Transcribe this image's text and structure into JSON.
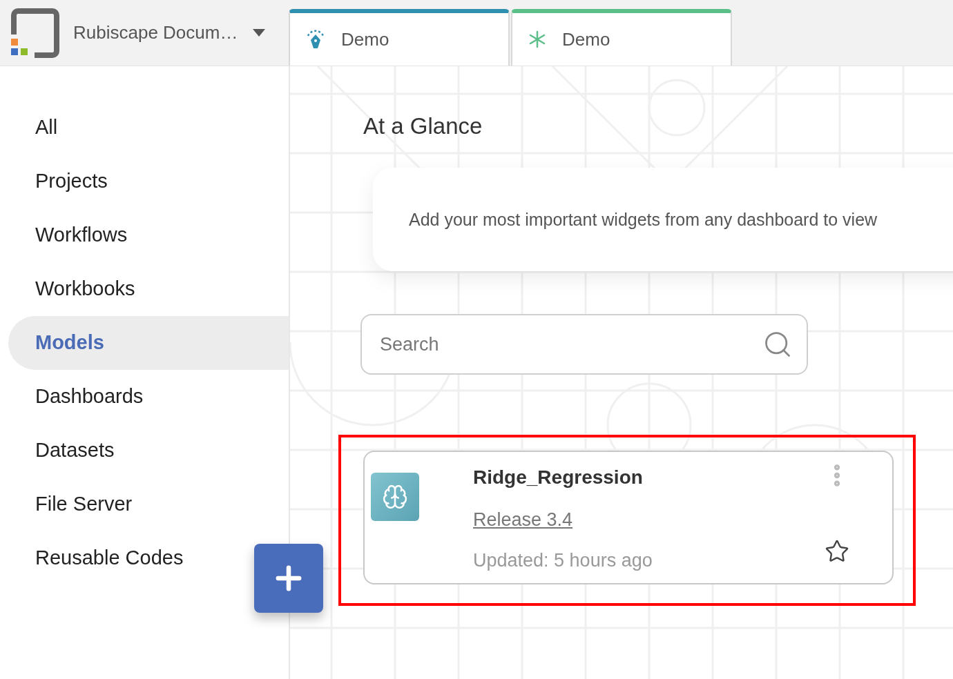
{
  "header": {
    "workspace": "Rubiscape Docum…",
    "tabs": [
      {
        "label": "Demo",
        "kind": "pen",
        "color": "#2f8fb0"
      },
      {
        "label": "Demo",
        "kind": "asterisk",
        "color": "#5cbf8a"
      }
    ]
  },
  "sidebar": {
    "items": [
      {
        "label": "All",
        "selected": false
      },
      {
        "label": "Projects",
        "selected": false
      },
      {
        "label": "Workflows",
        "selected": false
      },
      {
        "label": "Workbooks",
        "selected": false
      },
      {
        "label": "Models",
        "selected": true
      },
      {
        "label": "Dashboards",
        "selected": false
      },
      {
        "label": "Datasets",
        "selected": false
      },
      {
        "label": "File Server",
        "selected": false
      },
      {
        "label": "Reusable Codes",
        "selected": false
      }
    ]
  },
  "main": {
    "title": "At a Glance",
    "glance_message": "Add your most important widgets from any dashboard to view",
    "search": {
      "placeholder": "Search"
    },
    "models": [
      {
        "name": "Ridge_Regression",
        "release": "Release 3.4",
        "updated": "Updated: 5 hours ago",
        "starred": false
      }
    ]
  }
}
